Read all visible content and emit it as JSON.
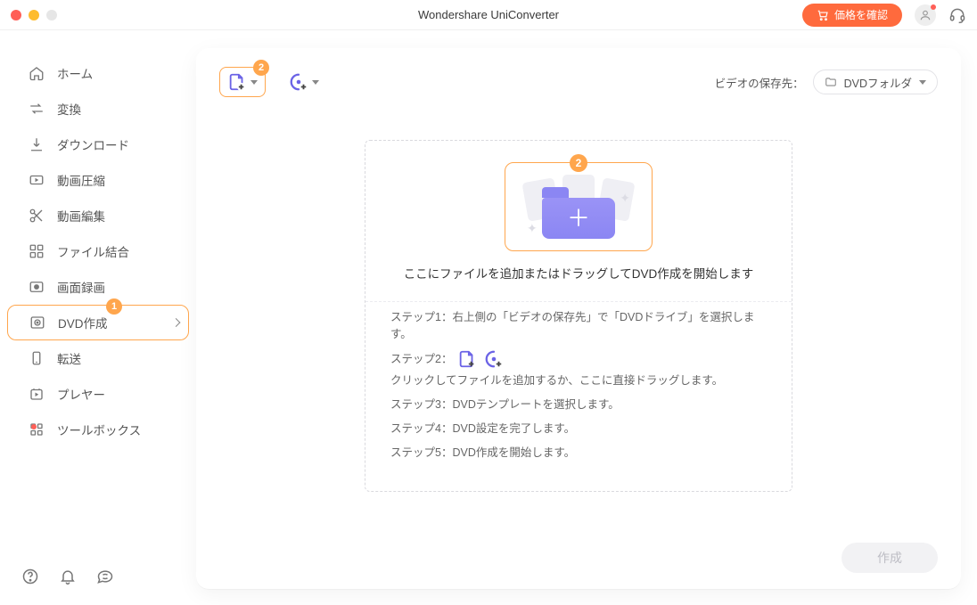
{
  "title": "Wondershare UniConverter",
  "price_button": "価格を確認",
  "sidebar": {
    "items": [
      {
        "label": "ホーム"
      },
      {
        "label": "変換"
      },
      {
        "label": "ダウンロード"
      },
      {
        "label": "動画圧縮"
      },
      {
        "label": "動画編集"
      },
      {
        "label": "ファイル結合"
      },
      {
        "label": "画面録画"
      },
      {
        "label": "DVD作成"
      },
      {
        "label": "転送"
      },
      {
        "label": "プレヤー"
      },
      {
        "label": "ツールボックス"
      }
    ]
  },
  "callouts": {
    "sidebar": "1",
    "toolbar": "2",
    "dropzone": "2"
  },
  "toolbar": {
    "save_label": "ビデオの保存先：",
    "destination": "DVDフォルダ"
  },
  "dropzone": {
    "title": "ここにファイルを追加またはドラッグしてDVD作成を開始します",
    "step1": "ステップ1：右上側の「ビデオの保存先」で「DVDドライブ」を選択します。",
    "step2_prefix": "ステップ2：",
    "step2_suffix": "クリックしてファイルを追加するか、ここに直接ドラッグします。",
    "step3": "ステップ3：DVDテンプレートを選択します。",
    "step4": "ステップ4：DVD設定を完了します。",
    "step5": "ステップ5：DVD作成を開始します。"
  },
  "create_button": "作成"
}
